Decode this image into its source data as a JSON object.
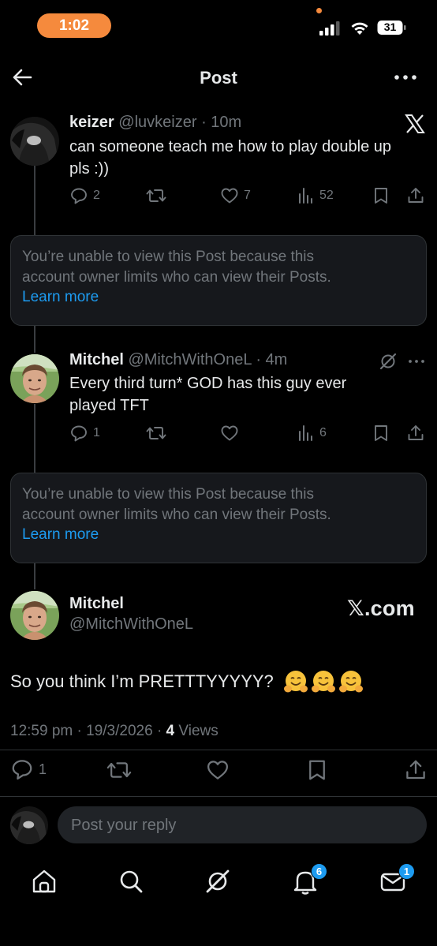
{
  "status_bar": {
    "time": "1:02",
    "battery": "31"
  },
  "header": {
    "title": "Post"
  },
  "posts": [
    {
      "name": "keizer",
      "handle": "@luvkeizer",
      "time": "· 10m",
      "text_lines": [
        "can someone teach me how to play double up",
        "pls :))"
      ],
      "replies": "2",
      "reposts": "",
      "likes": "7",
      "views": "52",
      "source_icon": "x-logo-icon"
    },
    {
      "name": "Mitchel",
      "handle": "@MitchWithOneL",
      "time": "· 4m",
      "text_lines": [
        "Every third turn* GOD has this guy ever",
        "played TFT"
      ],
      "replies": "1",
      "reposts": "",
      "likes": "",
      "views": "6",
      "source_icon": "grok-icon"
    }
  ],
  "limited_notice": {
    "lines": [
      "You’re unable to view this Post because this",
      "account owner limits who can view their Posts."
    ],
    "learn_more": "Learn more"
  },
  "main_post": {
    "name": "Mitchel",
    "handle": "@MitchWithOneL",
    "brand": "𝕏.com",
    "text": "So you think I’m PRETTTYYYYY?",
    "emoji_count": 3,
    "time": "12:59 pm",
    "date": "19/3/2026",
    "views_count": "4",
    "views_label": "Views",
    "replies": "1"
  },
  "reply": {
    "placeholder": "Post your reply"
  },
  "tabs": {
    "notifications_badge": "6",
    "messages_badge": "1"
  },
  "colors": {
    "background": "#000000",
    "accent": "#1d9bf0",
    "muted": "#71767b",
    "status_pill": "#f58a3d"
  }
}
